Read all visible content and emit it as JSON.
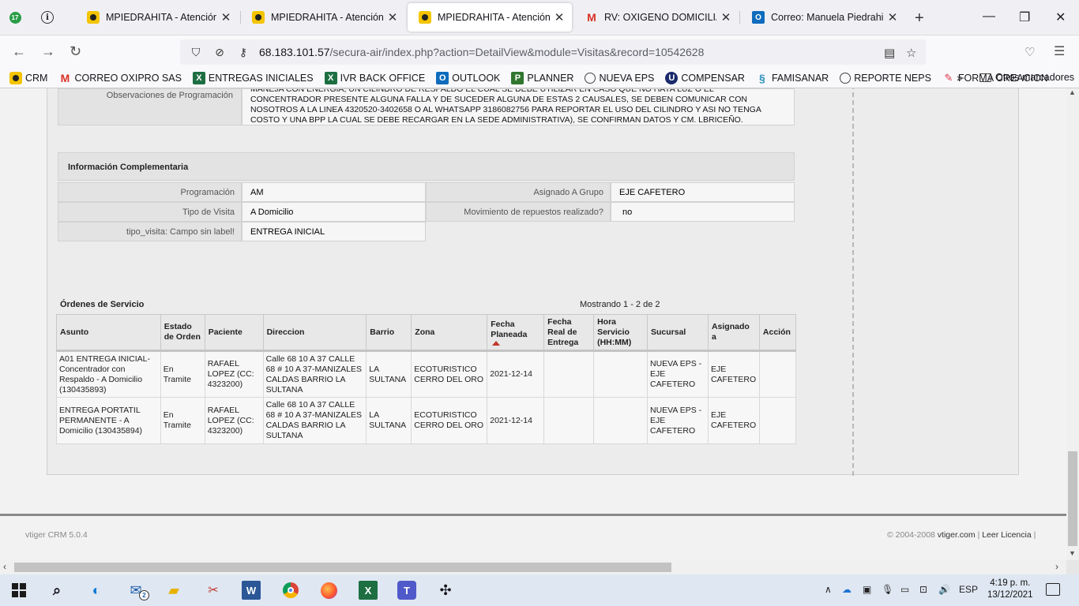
{
  "browser": {
    "tab_counter": "17",
    "tabs": [
      {
        "title": "MPIEDRAHITA - Atención al Usuario"
      },
      {
        "title": "MPIEDRAHITA - Atención al Usuario"
      },
      {
        "title": "MPIEDRAHITA - Atención al Usuario"
      },
      {
        "title": "RV: OXIGENO DOMICILIARIO"
      },
      {
        "title": "Correo: Manuela Piedrahita - Outlook"
      }
    ],
    "url_host": "68.183.101.57",
    "url_path": "/secura-air/index.php?action=DetailView&module=Visitas&record=10542628",
    "bookmarks": [
      {
        "label": "CRM",
        "icon": "crm-icon"
      },
      {
        "label": "CORREO OXIPRO SAS",
        "icon": "gmail-icon"
      },
      {
        "label": "ENTREGAS INICIALES",
        "icon": "excel-icon"
      },
      {
        "label": "IVR BACK OFFICE",
        "icon": "excel-icon"
      },
      {
        "label": "OUTLOOK",
        "icon": "outlook-icon"
      },
      {
        "label": "PLANNER",
        "icon": "planner-icon"
      },
      {
        "label": "NUEVA EPS",
        "icon": "globe-icon"
      },
      {
        "label": "COMPENSAR",
        "icon": "compensar-icon"
      },
      {
        "label": "FAMISANAR",
        "icon": "famisanar-icon"
      },
      {
        "label": "REPORTE NEPS",
        "icon": "globe-icon"
      },
      {
        "label": "FORMA CREACION",
        "icon": "forms-icon"
      }
    ],
    "other_bookmarks": "Otros marcadores"
  },
  "detail": {
    "obs_label": "Observaciones de Programación",
    "obs_text": "MANEJA CON ENERGIA, UN CILINDRO DE RESPALDO EL CUAL SE DEBE UTILIZAR EN CASO QUE NO HAYA LUZ O EL CONCENTRADOR PRESENTE ALGUNA FALLA Y DE SUCEDER ALGUNA DE ESTAS 2 CAUSALES, SE DEBEN COMUNICAR CON NOSOTROS A LA LINEA 4320520-3402658 O AL WHATSAPP 3186082756 PARA REPORTAR EL USO DEL CILINDRO Y ASI NO TENGA COSTO Y UNA BPP LA CUAL SE DEBE RECARGAR EN LA SEDE ADMINISTRATIVA), SE CONFIRMAN DATOS Y CM. LBRICEÑO.",
    "section_title": "Información Complementaria",
    "fields": {
      "programacion_label": "Programación",
      "programacion_value": "AM",
      "grupo_label": "Asignado A Grupo",
      "grupo_value": "EJE CAFETERO",
      "tipo_label": "Tipo de Visita",
      "tipo_value": "A Domicilio",
      "repuestos_label": "Movimiento de repuestos realizado?",
      "repuestos_value": "no",
      "tipo_visita_label": "tipo_visita: Campo sin label!",
      "tipo_visita_value": "ENTREGA INICIAL"
    }
  },
  "orders": {
    "title": "Órdenes de Servicio",
    "count": "Mostrando 1 - 2 de 2",
    "headers": [
      "Asunto",
      "Estado de Orden",
      "Paciente",
      "Direccion",
      "Barrio",
      "Zona",
      "Fecha Planeada",
      "Fecha Real de Entrega",
      "Hora Servicio (HH:MM)",
      "Sucursal",
      "Asignado a",
      "Acción"
    ],
    "rows": [
      [
        "A01 ENTREGA INICIAL-Concentrador con Respaldo - A Domicilio (130435893)",
        "En Tramite",
        "RAFAEL LOPEZ (CC: 4323200)",
        "Calle 68 10 A 37 CALLE 68 # 10 A 37-MANIZALES CALDAS BARRIO LA SULTANA",
        "LA SULTANA",
        "ECOTURISTICO CERRO DEL ORO",
        "2021-12-14",
        "",
        "",
        "NUEVA EPS - EJE CAFETERO",
        "EJE CAFETERO",
        ""
      ],
      [
        "ENTREGA PORTATIL PERMANENTE - A Domicilio (130435894)",
        "En Tramite",
        "RAFAEL LOPEZ (CC: 4323200)",
        "Calle 68 10 A 37 CALLE 68 # 10 A 37-MANIZALES CALDAS BARRIO LA SULTANA",
        "LA SULTANA",
        "ECOTURISTICO CERRO DEL ORO",
        "2021-12-14",
        "",
        "",
        "NUEVA EPS - EJE CAFETERO",
        "EJE CAFETERO",
        ""
      ]
    ]
  },
  "footer": {
    "version": "vtiger CRM 5.0.4",
    "copyright": "© 2004-2008",
    "link1": "vtiger.com",
    "link2": "Leer Licencia"
  },
  "taskbar": {
    "mail_badge": "2",
    "language": "ESP",
    "time": "4:19 p. m.",
    "date": "13/12/2021"
  }
}
